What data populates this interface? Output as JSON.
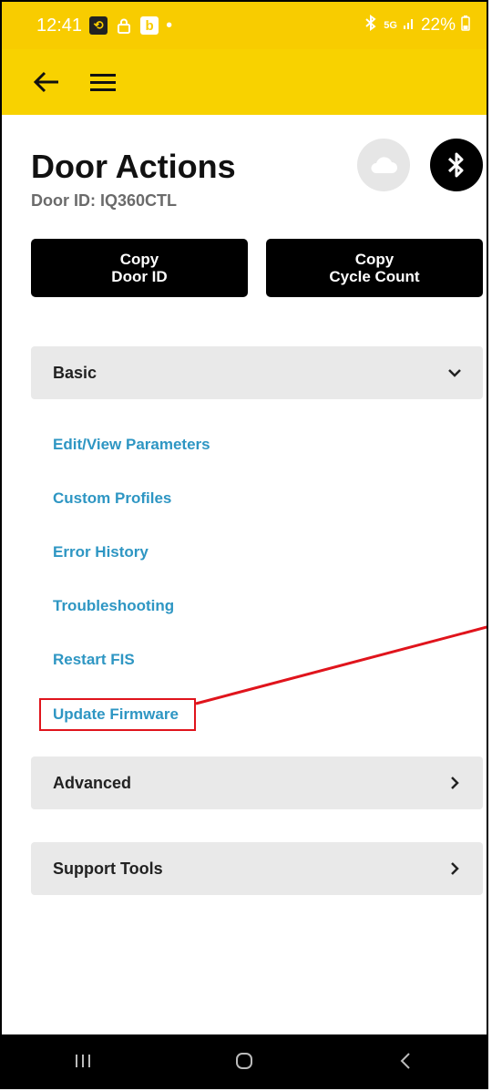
{
  "status_bar": {
    "time": "12:41",
    "battery": "22%",
    "dot": "•",
    "icons": [
      "sync-icon",
      "lock-icon",
      "b-app-icon",
      "bluetooth-icon",
      "5g-icon",
      "signal-icon",
      "battery-icon"
    ]
  },
  "app_bar": {
    "back_icon": "arrow-left-icon",
    "menu_icon": "hamburger-menu-icon"
  },
  "header": {
    "title": "Door Actions",
    "door_id": "Door ID: IQ360CTL"
  },
  "actions": {
    "copy_door_id_line1": "Copy",
    "copy_door_id_line2": "Door ID",
    "copy_cycle_line1": "Copy",
    "copy_cycle_line2": "Cycle Count"
  },
  "sections": {
    "basic": {
      "label": "Basic",
      "items": [
        "Edit/View Parameters",
        "Custom Profiles",
        "Error History",
        "Troubleshooting",
        "Restart FIS",
        "Update Firmware"
      ]
    },
    "advanced": {
      "label": "Advanced"
    },
    "support": {
      "label": "Support Tools"
    }
  },
  "colors": {
    "accent_yellow": "#f8d200",
    "link_blue": "#2e96c3",
    "annotation_red": "#e0141c"
  }
}
